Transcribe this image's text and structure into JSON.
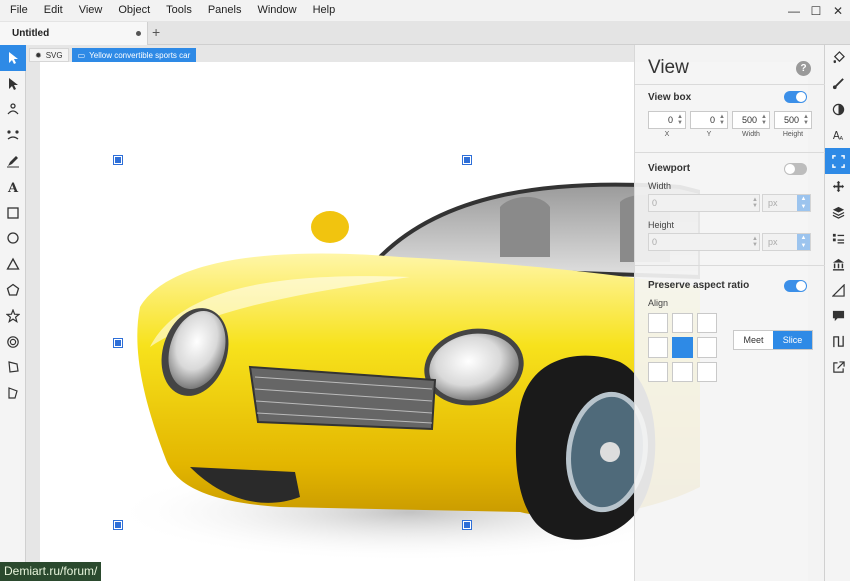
{
  "menu": [
    "File",
    "Edit",
    "View",
    "Object",
    "Tools",
    "Panels",
    "Window",
    "Help"
  ],
  "window_controls": {
    "minimize": "—",
    "maximize": "☐",
    "close": "✕"
  },
  "tabs": {
    "document": "Untitled",
    "new_tab": "+"
  },
  "tools": [
    {
      "name": "transform-tool-icon",
      "active": true
    },
    {
      "name": "edit-tool-icon"
    },
    {
      "name": "node-tool-icon"
    },
    {
      "name": "generator-tool-icon"
    },
    {
      "name": "pen-tool-icon"
    },
    {
      "name": "text-tool-icon"
    },
    {
      "name": "rectangle-tool-icon"
    },
    {
      "name": "ellipse-tool-icon"
    },
    {
      "name": "triangle-tool-icon"
    },
    {
      "name": "pentagon-tool-icon"
    },
    {
      "name": "star-tool-icon"
    },
    {
      "name": "ring-tool-icon"
    },
    {
      "name": "crop-tool-icon"
    },
    {
      "name": "flag-tool-icon"
    }
  ],
  "breadcrumb": {
    "root": "SVG",
    "selected": "Yellow convertible sports car"
  },
  "view_panel": {
    "title": "View",
    "help": "?",
    "view_box": {
      "title": "View box",
      "enabled": true,
      "fields": [
        {
          "label": "X",
          "value": "0"
        },
        {
          "label": "Y",
          "value": "0"
        },
        {
          "label": "Width",
          "value": "500"
        },
        {
          "label": "Height",
          "value": "500"
        }
      ]
    },
    "viewport": {
      "title": "Viewport",
      "enabled": false,
      "width_label": "Width",
      "width_value": "0",
      "height_label": "Height",
      "height_value": "0",
      "unit": "px"
    },
    "preserve_aspect_ratio": {
      "title": "Preserve aspect ratio",
      "enabled": true,
      "align_label": "Align",
      "align_active_index": 4,
      "meet_label": "Meet",
      "slice_label": "Slice",
      "selected_mode": "Slice"
    }
  },
  "right_panels": [
    {
      "name": "fill-panel-icon"
    },
    {
      "name": "stroke-panel-icon"
    },
    {
      "name": "compositing-panel-icon"
    },
    {
      "name": "typography-panel-icon"
    },
    {
      "name": "view-panel-icon",
      "active": true
    },
    {
      "name": "transform-panel-icon"
    },
    {
      "name": "layers-panel-icon"
    },
    {
      "name": "objects-panel-icon"
    },
    {
      "name": "library-panel-icon"
    },
    {
      "name": "geometry-panel-icon"
    },
    {
      "name": "comments-panel-icon"
    },
    {
      "name": "paths-panel-icon"
    },
    {
      "name": "export-panel-icon"
    }
  ],
  "watermark": "Demiart.ru/forum/",
  "colors": {
    "accent": "#2e8ae6",
    "car_body": "#f5d90a"
  }
}
